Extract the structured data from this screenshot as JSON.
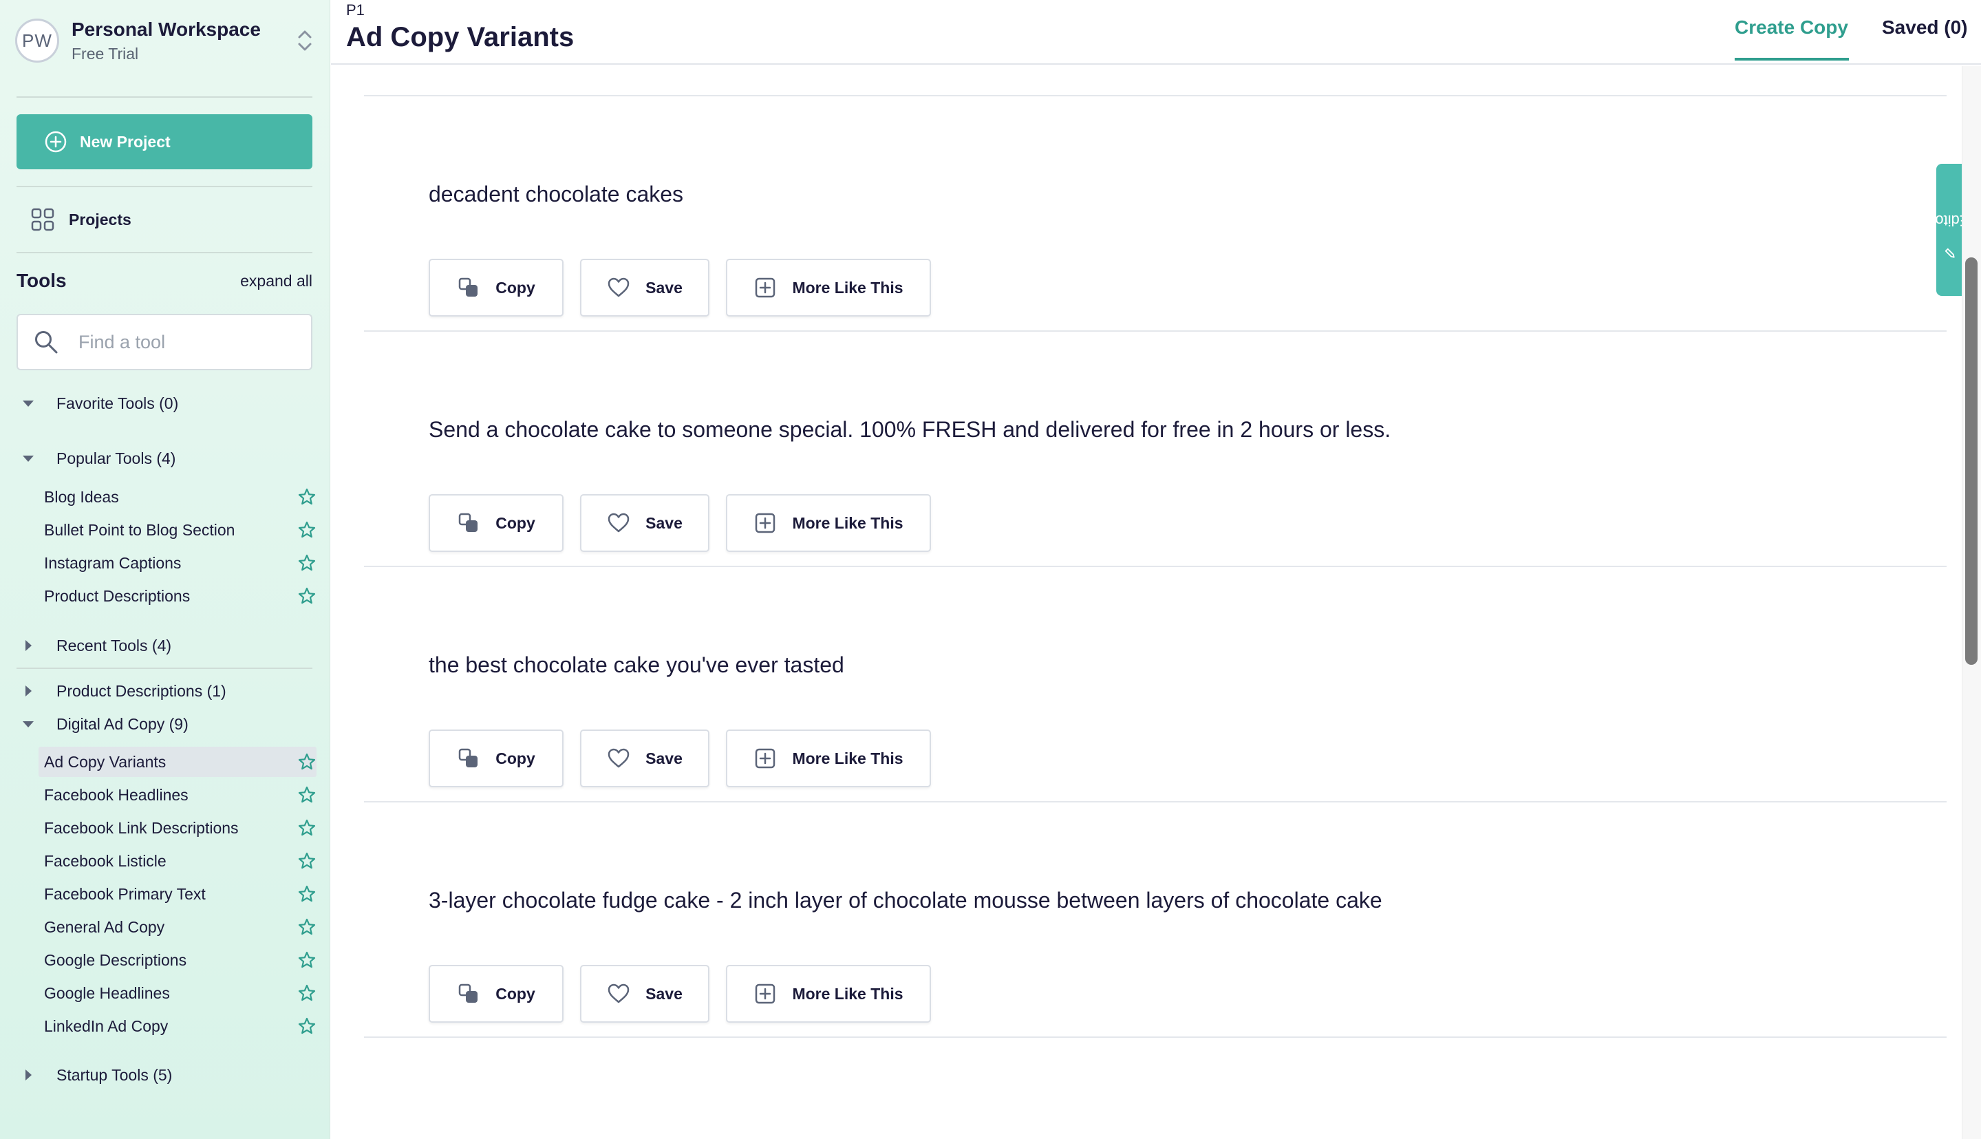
{
  "workspace": {
    "initials": "PW",
    "name": "Personal Workspace",
    "plan": "Free Trial"
  },
  "sidebar": {
    "new_project_label": "New Project",
    "projects_label": "Projects",
    "tools_title": "Tools",
    "expand_all": "expand all",
    "search_placeholder": "Find a tool",
    "groups": {
      "favorite": "Favorite Tools (0)",
      "popular": "Popular Tools (4)",
      "recent": "Recent Tools (4)",
      "product": "Product Descriptions (1)",
      "digital": "Digital Ad Copy (9)",
      "startup": "Startup Tools (5)"
    },
    "popular_tools": [
      "Blog Ideas",
      "Bullet Point to Blog Section",
      "Instagram Captions",
      "Product Descriptions"
    ],
    "digital_tools": [
      "Ad Copy Variants",
      "Facebook Headlines",
      "Facebook Link Descriptions",
      "Facebook Listicle",
      "Facebook Primary Text",
      "General Ad Copy",
      "Google Descriptions",
      "Google Headlines",
      "LinkedIn Ad Copy"
    ],
    "active_tool": "Ad Copy Variants"
  },
  "header": {
    "breadcrumb": "P1",
    "title": "Ad Copy Variants",
    "tabs": {
      "create": "Create Copy",
      "saved": "Saved (0)"
    }
  },
  "results": [
    "decadent chocolate cakes",
    "Send a chocolate cake to someone special. 100% FRESH and delivered for free in 2 hours or less.",
    "the best chocolate cake you've ever tasted",
    "3-layer chocolate fudge cake - 2 inch layer of chocolate mousse between layers of chocolate cake"
  ],
  "buttons": {
    "copy": "Copy",
    "save": "Save",
    "more": "More Like This"
  },
  "editor_tab": "Editor",
  "colors": {
    "accent": "#48b7a7",
    "text": "#1c1b3a",
    "sidebar_bg": "#e2f6ee"
  }
}
